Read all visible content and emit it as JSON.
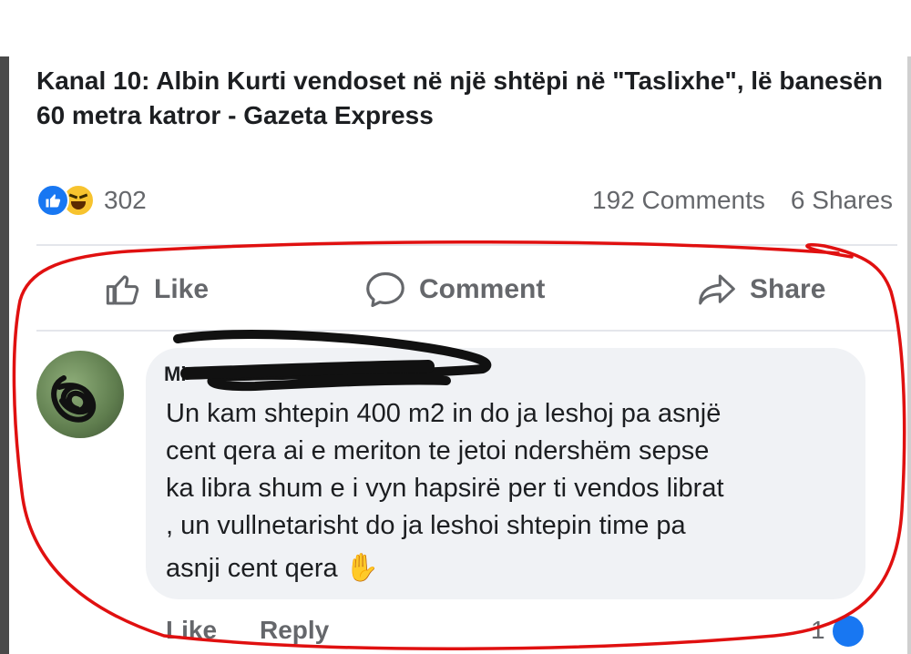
{
  "post": {
    "headline": "Kanal 10: Albin Kurti vendoset në një shtëpi në \"Taslixhe\", lë banesën 60 metra katror - Gazeta Express"
  },
  "reactions": {
    "icons": [
      "like-icon",
      "haha-icon"
    ],
    "count": "302",
    "comments": "192 Comments",
    "shares": "6 Shares"
  },
  "actions": {
    "like": "Like",
    "comment": "Comment",
    "share": "Share"
  },
  "comment": {
    "author": "Mi",
    "lines": [
      "Un kam shtepin 400 m2 in do ja leshoj pa asnjë",
      "cent qera ai e meriton te jetoi ndershëm sepse",
      "ka libra shum e i vyn hapsirë per ti vendos librat",
      ", un vullnetarisht do ja leshoi shtepin time pa",
      "asnji cent qera"
    ],
    "emoji": "✋",
    "footer": {
      "like": "Like",
      "reply": "Reply",
      "reaction_count": "1"
    }
  },
  "colors": {
    "facebook_blue": "#1877f2",
    "annotation_red": "#e01010",
    "bubble_bg": "#f0f2f5",
    "muted_text": "#65676b"
  }
}
